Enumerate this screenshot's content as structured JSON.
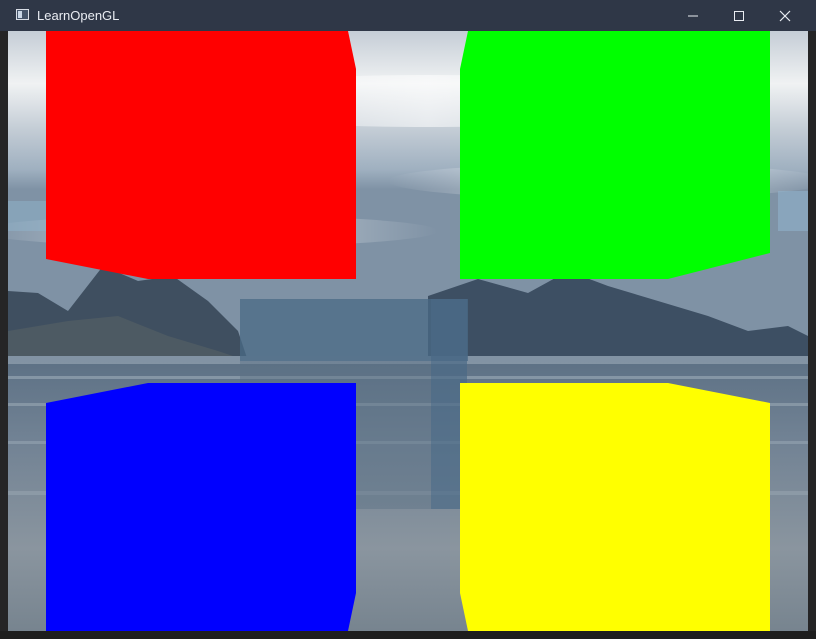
{
  "window": {
    "title": "LearnOpenGL",
    "icon": "app-window-icon",
    "controls": {
      "minimize_icon": "minimize-icon",
      "maximize_icon": "maximize-icon",
      "close_icon": "close-icon"
    }
  },
  "scene": {
    "quads": [
      {
        "name": "red-quad",
        "color": "#ff0000"
      },
      {
        "name": "green-quad",
        "color": "#00ff00"
      },
      {
        "name": "blue-quad",
        "color": "#0000ff"
      },
      {
        "name": "yellow-quad",
        "color": "#ffff00"
      }
    ],
    "center_panel_color": "#4a6a86"
  },
  "colors": {
    "titlebar": "#2f3747",
    "title_text": "#e9ecf2"
  }
}
